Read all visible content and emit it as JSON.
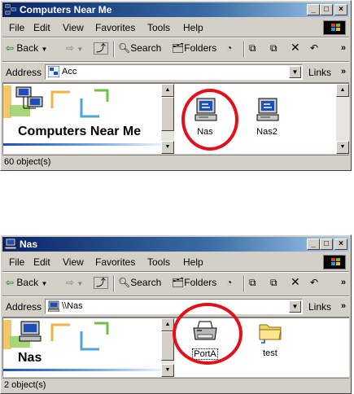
{
  "windows": [
    {
      "title": "Computers Near Me",
      "menu": [
        "File",
        "Edit",
        "View",
        "Favorites",
        "Tools",
        "Help"
      ],
      "toolbar": {
        "back": "Back",
        "search": "Search",
        "folders": "Folders",
        "overflow": "»"
      },
      "address": {
        "label": "Address",
        "value": "Acc",
        "links": "Links",
        "links_overflow": "»"
      },
      "banner_title": "Computers Near Me",
      "items": [
        {
          "label": "Nas",
          "icon": "computer-icon"
        },
        {
          "label": "Nas2",
          "icon": "computer-icon"
        }
      ],
      "status": "60 object(s)",
      "highlight_color": "#e3101a"
    },
    {
      "title": "Nas",
      "menu": [
        "File",
        "Edit",
        "View",
        "Favorites",
        "Tools",
        "Help"
      ],
      "toolbar": {
        "back": "Back",
        "search": "Search",
        "folders": "Folders",
        "overflow": "»"
      },
      "address": {
        "label": "Address",
        "value": "\\\\Nas",
        "links": "Links",
        "links_overflow": "»"
      },
      "banner_title": "Nas",
      "items": [
        {
          "label": "PortA",
          "icon": "printer-icon"
        },
        {
          "label": "test",
          "icon": "folder-icon"
        }
      ],
      "status": "2 object(s)",
      "highlight_color": "#e3101a"
    }
  ],
  "title_buttons": {
    "minimize": "_",
    "maximize": "□",
    "close": "×"
  }
}
